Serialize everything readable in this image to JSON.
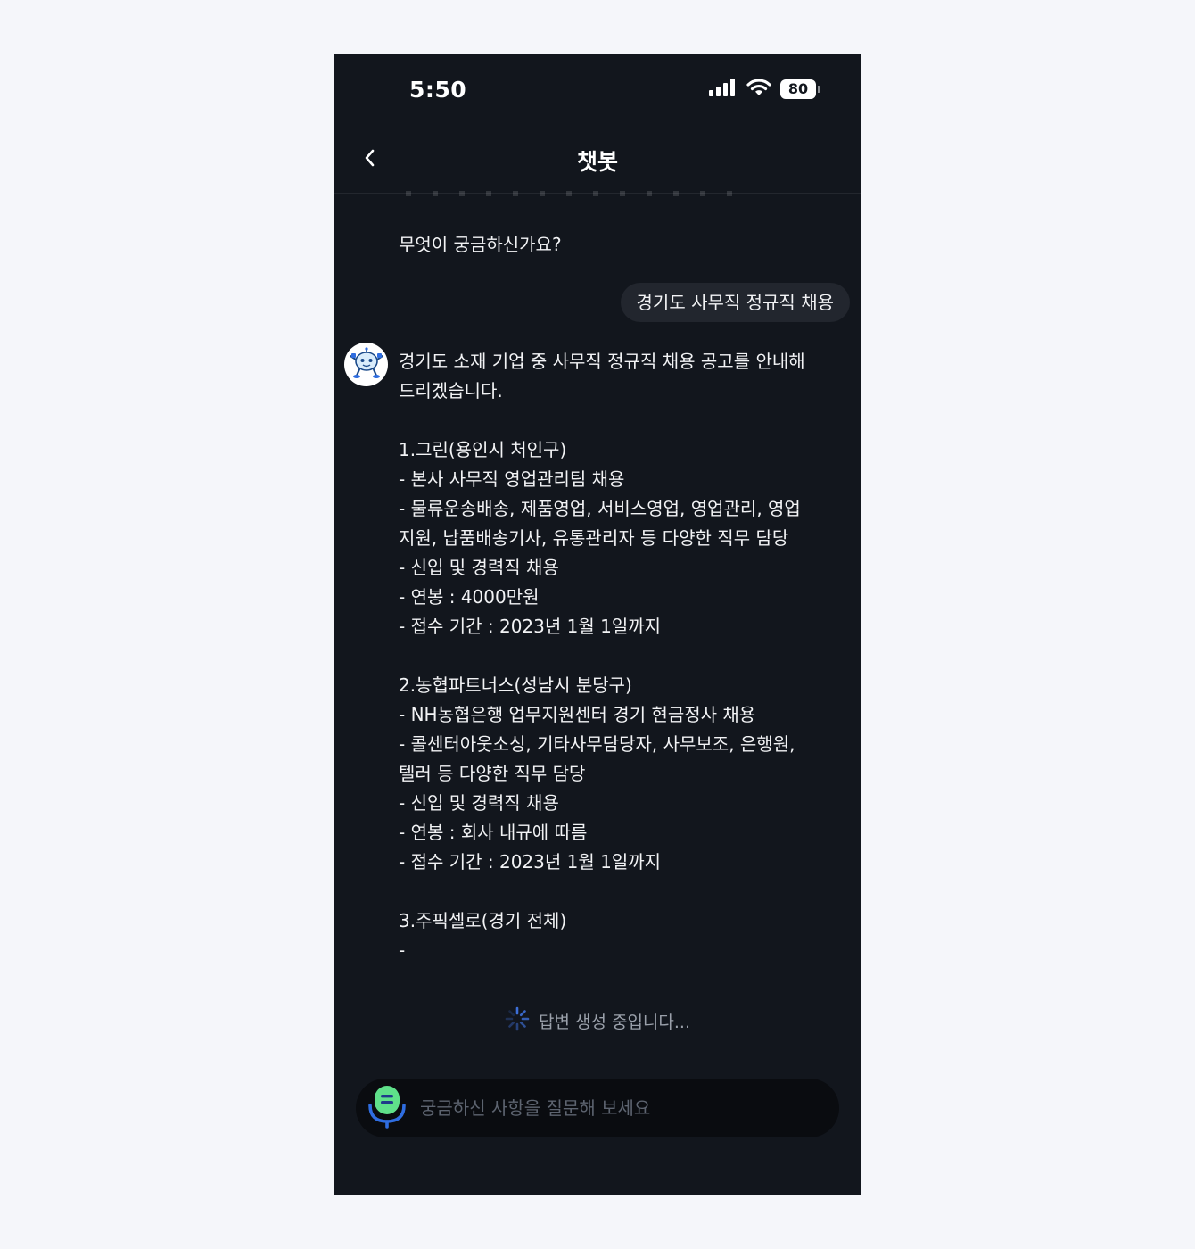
{
  "status_bar": {
    "time": "5:50",
    "battery": "80",
    "icons": [
      "signal-icon",
      "wifi-icon",
      "battery-icon"
    ]
  },
  "header": {
    "title": "챗봇",
    "back_icon": "chevron-left-icon"
  },
  "conversation": {
    "prompt": "무엇이 궁금하신가요?",
    "user_message": "경기도 사무직 정규직 채용",
    "bot_avatar": "robot-mascot-icon",
    "bot_lines": [
      "경기도 소재 기업 중 사무직 정규직 채용 공고를 안내해",
      "드리겠습니다.",
      "",
      "1.그린(용인시 처인구)",
      "- 본사 사무직 영업관리팀 채용",
      "- 물류운송배송, 제품영업, 서비스영업, 영업관리, 영업",
      "지원, 납품배송기사, 유통관리자 등 다양한 직무 담당",
      "- 신입 및 경력직 채용",
      "- 연봉 : 4000만원",
      "- 접수 기간 : 2023년 1월 1일까지",
      "",
      "2.농협파트너스(성남시 분당구)",
      "- NH농협은행 업무지원센터 경기 현금정사 채용",
      "- 콜센터아웃소싱, 기타사무담당자, 사무보조, 은행원,",
      "텔러 등 다양한 직무 담당",
      "- 신입 및 경력직 채용",
      "- 연봉 : 회사 내규에 따름",
      "- 접수 기간 : 2023년 1월 1일까지",
      "",
      "3.주픽셀로(경기 전체)",
      "-"
    ]
  },
  "generating": {
    "label": "답변 생성 중입니다...",
    "icon": "loading-spinner-icon"
  },
  "input": {
    "placeholder": "궁금하신 사항을 질문해 보세요",
    "value": "",
    "mic_icon": "microphone-icon"
  },
  "colors": {
    "background": "#12161d",
    "bubble": "#22262e",
    "input_bg": "#0a0c10",
    "mic_green": "#5fe08a",
    "mic_blue": "#2f6de0",
    "spinner": "#3d6fd8"
  }
}
